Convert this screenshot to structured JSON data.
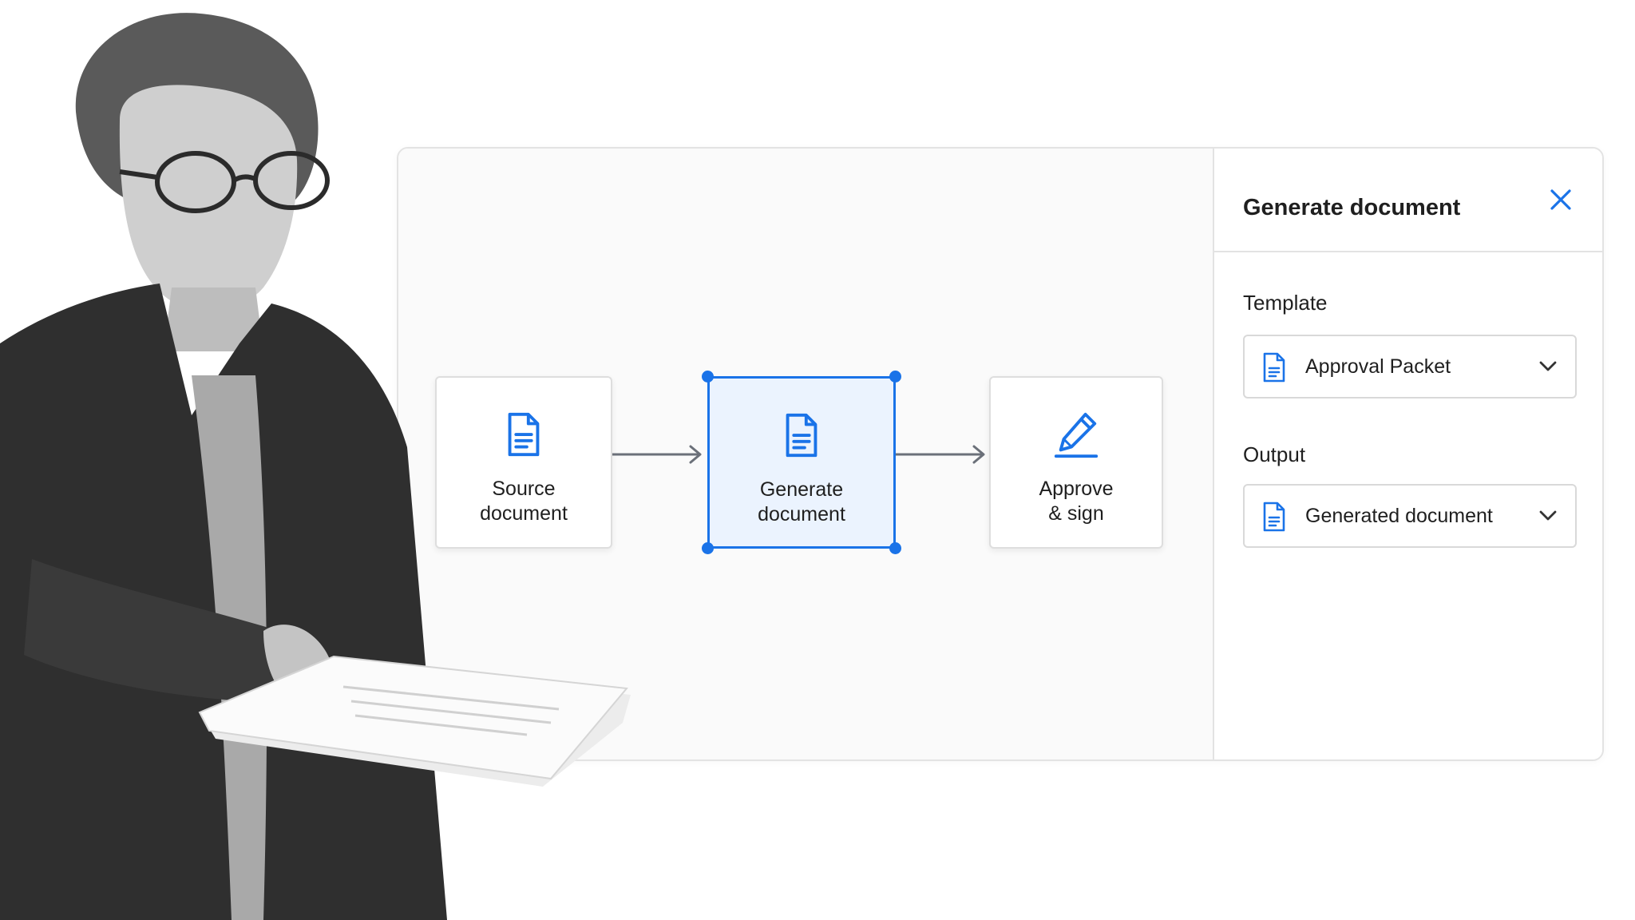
{
  "canvas": {
    "nodes": [
      {
        "id": "source",
        "label": "Source\ndocument",
        "icon": "document-icon"
      },
      {
        "id": "generate",
        "label": "Generate\ndocument",
        "icon": "document-icon",
        "selected": true
      },
      {
        "id": "approve",
        "label": "Approve\n& sign",
        "icon": "pencil-sign-icon"
      }
    ]
  },
  "panel": {
    "title": "Generate document",
    "template": {
      "label": "Template",
      "value": "Approval Packet"
    },
    "output": {
      "label": "Output",
      "value": "Generated document"
    }
  },
  "colors": {
    "accent": "#1a73e8",
    "selected_bg": "#ebf3fe",
    "border": "#dedede"
  }
}
